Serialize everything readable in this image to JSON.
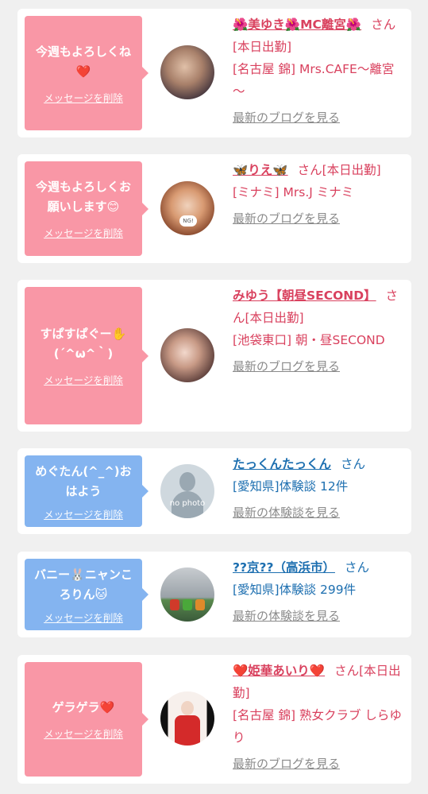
{
  "colors": {
    "pink": "#f997a6",
    "blue": "#84b4f0",
    "name_pink": "#d9415e",
    "name_blue": "#1d6fb0"
  },
  "cards": [
    {
      "message": "今週もよろしくね❤️",
      "delete_label": "メッセージを削除",
      "name": "🌺美ゆき🌺MC離宮🌺",
      "suffix": "さん[本日出勤]",
      "shop": "[名古屋 錦] Mrs.CAFE～離宮～",
      "link": "最新のブログを見る"
    },
    {
      "message": "今週もよろしくお願いします😊",
      "delete_label": "メッセージを削除",
      "name": "🦋りえ🦋",
      "suffix": "さん[本日出勤]",
      "shop": "[ミナミ] Mrs.J ミナミ",
      "link": "最新のブログを見る",
      "avatar_badge": "NG!"
    },
    {
      "message": "すぱすぱぐー✋(´^ω^｀)",
      "delete_label": "メッセージを削除",
      "name": "みゆう【朝昼SECOND】",
      "suffix": "さん[本日出勤]",
      "shop": "[池袋東口] 朝・昼SECOND",
      "link": "最新のブログを見る"
    },
    {
      "message": "めぐたん(^_^)おはよう",
      "delete_label": "メッセージを削除",
      "name": "たっくんたっくん",
      "suffix": "さん",
      "shop": "[愛知県]体験談 12件",
      "link": "最新の体験談を見る",
      "avatar_text": "no photo"
    },
    {
      "message": "バニー🐰ニャンころりん🐱",
      "delete_label": "メッセージを削除",
      "name": "??京??（高浜市）",
      "suffix": "さん",
      "shop": "[愛知県]体験談 299件",
      "link": "最新の体験談を見る"
    },
    {
      "message": "ゲラゲラ❤️",
      "delete_label": "メッセージを削除",
      "name": "❤️姫華あいり❤️",
      "suffix": "さん[本日出勤]",
      "shop": "[名古屋 錦] 熟女クラブ しらゆり",
      "link": "最新のブログを見る"
    }
  ]
}
